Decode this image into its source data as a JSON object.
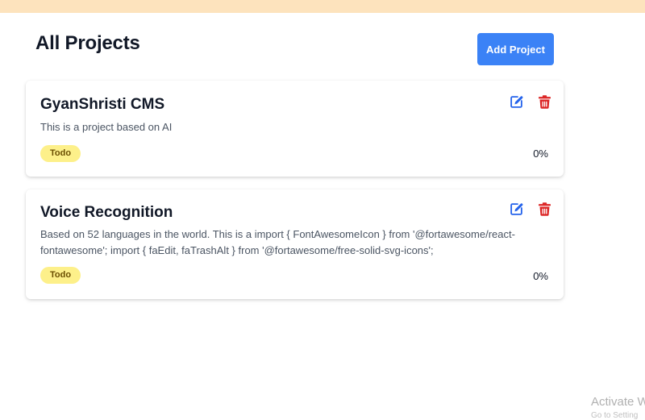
{
  "header": {
    "title": "All Projects",
    "add_button_label": "Add Project"
  },
  "projects": [
    {
      "title": "GyanShristi CMS",
      "description": "This is a project based on AI",
      "status": "Todo",
      "progress": "0%",
      "edit_icon": "edit-icon",
      "delete_icon": "trash-icon"
    },
    {
      "title": "Voice Recognition",
      "description": "Based on 52 languages in the world. This is a import { FontAwesomeIcon } from '@fortawesome/react-fontawesome'; import { faEdit, faTrashAlt } from '@fortawesome/free-solid-svg-icons';",
      "status": "Todo",
      "progress": "0%",
      "edit_icon": "edit-icon",
      "delete_icon": "trash-icon"
    }
  ],
  "watermark": {
    "title": "Activate W",
    "subtitle": "Go to Setting"
  },
  "colors": {
    "accent": "#3b82f6",
    "edit_icon": "#2563eb",
    "delete_icon": "#dc2626",
    "badge_bg": "#fdf08a",
    "top_bar": "#fde3bd"
  }
}
